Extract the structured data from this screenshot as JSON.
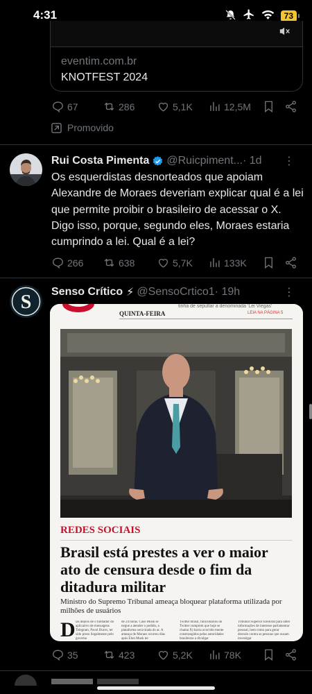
{
  "status_bar": {
    "time": "4:31",
    "battery": "73"
  },
  "promoted_tweet": {
    "card_domain": "eventim.com.br",
    "card_title": "KNOTFEST 2024",
    "replies": "67",
    "reposts": "286",
    "likes": "5,1K",
    "views": "12,5M",
    "promoted_label": "Promovido"
  },
  "tweet1": {
    "name": "Rui Costa Pimenta",
    "handle": "@Ruicpiment...",
    "time": "· 1d",
    "text": "Os esquerdistas desnorteados que apoiam Alexandre de Moraes deveriam explicar qual é a lei que permite proibir o brasileiro de acessar o X. Digo isso, porque, segundo eles, Moraes estaria cumprindo a lei. Qual é a lei?",
    "replies": "266",
    "reposts": "638",
    "likes": "5,7K",
    "views": "133K"
  },
  "tweet2": {
    "name": "Senso Crítico",
    "emoji": "⚡",
    "handle": "@SensoCrtico1",
    "time": "· 19h",
    "newspaper": {
      "day": "QUINTA-FEIRA",
      "top_fine": "tinha de sepultar a denominada 'Lei Viegas'",
      "top_fine_red": "LEIA NA PÁGINA 5",
      "section": "REDES SOCIAIS",
      "headline": "Brasil está prestes a ver o maior ato de censura desde o fim da ditadura militar",
      "subhead": "Ministro do Supremo Tribunal ameaça bloquear plataforma utilizada por milhões de usuários",
      "dropcap": "D",
      "col1": "ias depois de o fundador do aplicativo de mensagens Telegram, Pavel Durov, ter sido preso ilegalmente pelo governo",
      "col2": "de 24 horas. Caso Musk se negue a atender o pedido, a plataforma será tirada do ar. A ameaça de Moraes ocorreu dias após Elon Musk ter",
      "col3": "Twitter Brasil, funcionários do Twitter cumprem que hoje se chama X) havia ocorrido mente constrangidos pelas autoridades brasileiras a divulgar",
      "col4": "Tribunal Superior Eleitoral para obter informações de interesse parlamentar pessoal, bem como para gerar desvalo contra as pessoas que ousam investigar"
    },
    "replies": "35",
    "reposts": "423",
    "likes": "5,2K",
    "views": "78K"
  },
  "colors": {
    "accent": "#1d9bf0",
    "muted": "#71767b",
    "red_section": "#c8102e"
  }
}
